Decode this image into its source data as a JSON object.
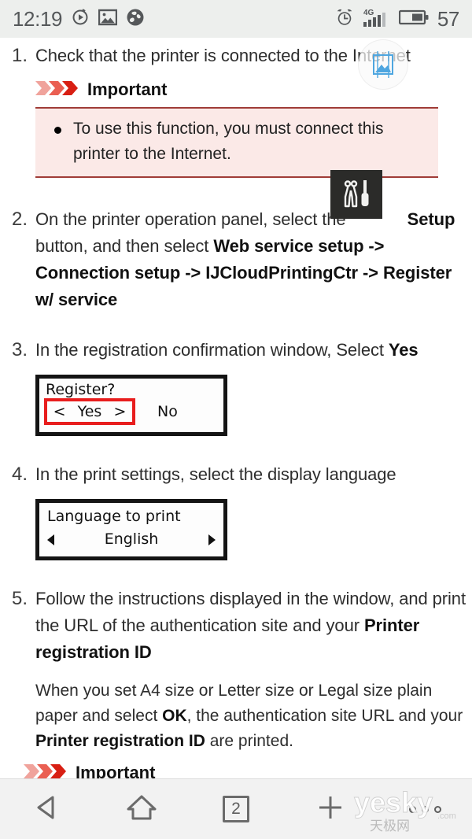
{
  "statusbar": {
    "time": "12:19",
    "battery_percent": "57",
    "icons": [
      {
        "name": "media-player-icon"
      },
      {
        "name": "gallery-image-icon"
      },
      {
        "name": "browser-globe-icon"
      },
      {
        "name": "alarm-clock-icon"
      },
      {
        "name": "signal-4g-icon",
        "label": "4G"
      },
      {
        "name": "battery-icon"
      }
    ]
  },
  "overlay": {
    "name": "screenshot-capture-icon",
    "accent": "#4ea6e0"
  },
  "article": {
    "steps": [
      {
        "number": "1.",
        "text_plain": "Check that the printer is connected to the Internet",
        "important": {
          "heading": "Important",
          "items": [
            "To use this function, you must connect this printer to the Internet."
          ]
        }
      },
      {
        "number": "2.",
        "lead": "On the printer operation panel, select the",
        "bold_1": "Setup",
        "mid_1": " button, and then select ",
        "bold_2": "Web service setup",
        "mid_2": " -> ",
        "bold_3": "Connection setup",
        "mid_3": " -> ",
        "bold_4": "IJCloudPrintingCtr",
        "mid_4": " -> ",
        "bold_5": "Register w/ service",
        "icon_name": "printer-setup-tools-icon"
      },
      {
        "number": "3.",
        "lead": "In the registration confirmation window, Select ",
        "bold_1": "Yes",
        "lcd": {
          "name": "printer-lcd-register-confirm",
          "line1": "Register?",
          "selected": "Yes",
          "arrow_left": "<",
          "arrow_right": ">",
          "other_option": "No",
          "highlight_color": "#e81d1d"
        }
      },
      {
        "number": "4.",
        "lead": "In the print settings, select the display language",
        "lcd": {
          "name": "printer-lcd-language-select",
          "line1": "Language to print",
          "value": "English"
        }
      },
      {
        "number": "5.",
        "lead": "Follow the instructions displayed in the window, and print the URL of the authentication site and your ",
        "bold_1": "Printer registration ID",
        "note_part1": "When you set A4 size or Letter size or Legal size plain paper and select ",
        "note_bold1": "OK",
        "note_part2": ", the authentication site URL and your ",
        "note_bold2": "Printer registration ID",
        "note_part3": " are printed."
      }
    ],
    "important_2": {
      "heading": "Important"
    }
  },
  "navbar": {
    "back": "back-icon",
    "home": "home-icon",
    "tabs_label": "2",
    "new_tab": "plus-icon",
    "menu": "menu-dots-icon"
  },
  "watermark": {
    "text": "yesky",
    "suffix": ".com",
    "cn": "天极网"
  }
}
